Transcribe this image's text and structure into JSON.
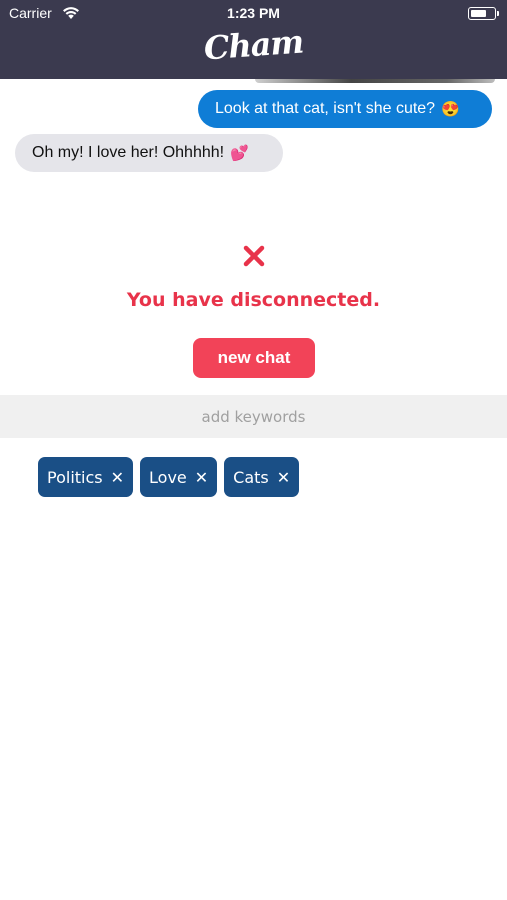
{
  "status_bar": {
    "carrier": "Carrier",
    "time": "1:23 PM",
    "battery_level": 0.7
  },
  "header": {
    "logo": "Cham",
    "background": "#3b3a4f"
  },
  "messages": [
    {
      "direction": "outgoing",
      "text": "Look at that cat, isn't she cute?",
      "emoji": "😍",
      "color": "#0f7dd6"
    },
    {
      "direction": "incoming",
      "text": "Oh my! I love her! Ohhhhh!",
      "emoji": "💕",
      "color": "#e5e5ea"
    }
  ],
  "disconnect": {
    "icon": "close-icon",
    "message": "You have disconnected.",
    "color": "#e8334a",
    "button_label": "new chat",
    "button_color": "#f24358"
  },
  "keywords": {
    "placeholder": "add keywords",
    "value": "",
    "tags": [
      {
        "label": "Politics",
        "remove_icon": "close-icon"
      },
      {
        "label": "Love",
        "remove_icon": "close-icon"
      },
      {
        "label": "Cats",
        "remove_icon": "close-icon"
      }
    ],
    "tag_color": "#1a4f86"
  }
}
